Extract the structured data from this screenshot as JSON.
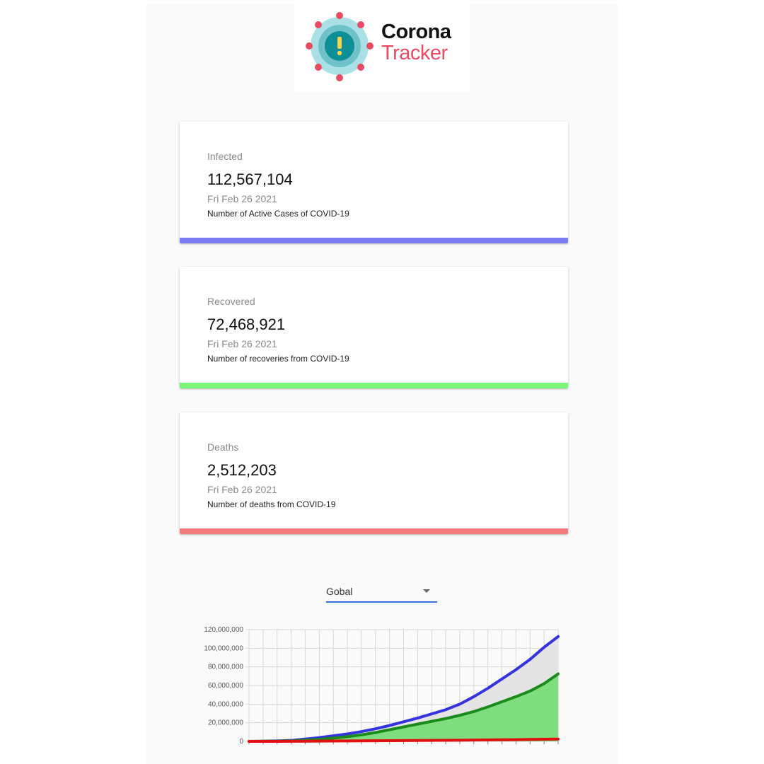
{
  "logo": {
    "word1": "Corona",
    "word2": "Tracker"
  },
  "cards": [
    {
      "label": "Infected",
      "value": "112,567,104",
      "date": "Fri Feb 26 2021",
      "description": "Number of Active Cases of COVID-19",
      "color": "#7c7cf5"
    },
    {
      "label": "Recovered",
      "value": "72,468,921",
      "date": "Fri Feb 26 2021",
      "description": "Number of recoveries from COVID-19",
      "color": "#7cf57c"
    },
    {
      "label": "Deaths",
      "value": "2,512,203",
      "date": "Fri Feb 26 2021",
      "description": "Number of deaths from COVID-19",
      "color": "#f57c7c"
    }
  ],
  "selector": {
    "value": "Gobal"
  },
  "chart_data": {
    "type": "area",
    "x_count": 23,
    "ylim": [
      0,
      120000000
    ],
    "yticks": [
      "0",
      "20,000,000",
      "40,000,000",
      "60,000,000",
      "80,000,000",
      "100,000,000",
      "120,000,000"
    ],
    "grid": true,
    "series": [
      {
        "color": "#3333e0",
        "fill": "#e4e4e4",
        "values": [
          0,
          200000,
          500000,
          1000000,
          2500000,
          4000000,
          6000000,
          8000000,
          10500000,
          13500000,
          17000000,
          21000000,
          25000000,
          29500000,
          34000000,
          40000000,
          48000000,
          57000000,
          67000000,
          77000000,
          88000000,
          101000000,
          112567104
        ]
      },
      {
        "color": "#1a8a1a",
        "fill": "#7fdc7f",
        "values": [
          0,
          100000,
          200000,
          500000,
          1200000,
          2200000,
          3500000,
          5000000,
          7000000,
          9500000,
          12500000,
          15500000,
          18500000,
          21500000,
          24500000,
          28000000,
          32000000,
          37000000,
          42500000,
          48000000,
          54000000,
          62000000,
          72468921
        ]
      },
      {
        "color": "#e01010",
        "fill": "none",
        "values": [
          0,
          10000,
          30000,
          70000,
          150000,
          250000,
          350000,
          450000,
          550000,
          650000,
          750000,
          850000,
          950000,
          1050000,
          1150000,
          1250000,
          1400000,
          1550000,
          1700000,
          1850000,
          2050000,
          2300000,
          2512203
        ]
      }
    ]
  }
}
